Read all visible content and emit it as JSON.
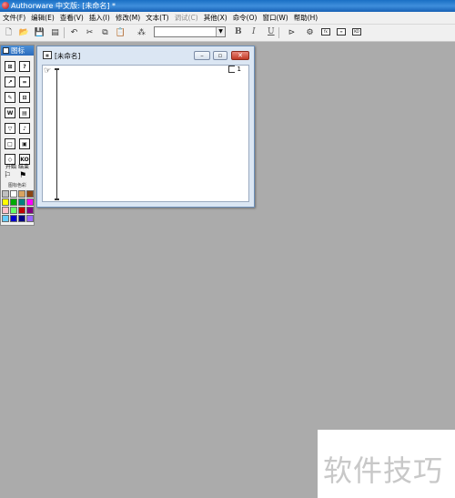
{
  "window": {
    "title": "Authorware 中文版: [未命名] *"
  },
  "menu": [
    {
      "label": "文件(F)",
      "disabled": false
    },
    {
      "label": "编辑(E)",
      "disabled": false
    },
    {
      "label": "查看(V)",
      "disabled": false
    },
    {
      "label": "插入(I)",
      "disabled": false
    },
    {
      "label": "修改(M)",
      "disabled": false
    },
    {
      "label": "文本(T)",
      "disabled": false
    },
    {
      "label": "调试(C)",
      "disabled": true
    },
    {
      "label": "其他(X)",
      "disabled": false
    },
    {
      "label": "命令(O)",
      "disabled": false
    },
    {
      "label": "窗口(W)",
      "disabled": false
    },
    {
      "label": "帮助(H)",
      "disabled": false
    }
  ],
  "toolbar": {
    "style_value": "",
    "bold_label": "B",
    "italic_label": "I",
    "underline_label": "U",
    "icons": [
      "new-file-icon",
      "open-file-icon",
      "save-all-icon",
      "import-icon",
      "undo-icon",
      "cut-icon",
      "copy-icon",
      "paste-icon",
      "find-icon"
    ],
    "right_icons": [
      "run-icon",
      "control-panel-icon",
      "functions-icon",
      "variables-icon",
      "knowledge-objects-icon"
    ]
  },
  "palette": {
    "title": "图标",
    "icons": [
      {
        "name": "display-icon",
        "glyph": "⊞"
      },
      {
        "name": "interaction-icon",
        "glyph": "?"
      },
      {
        "name": "motion-icon",
        "glyph": "↗"
      },
      {
        "name": "calculation-icon",
        "glyph": "="
      },
      {
        "name": "erase-icon",
        "glyph": "✎"
      },
      {
        "name": "map-icon",
        "glyph": "⊟"
      },
      {
        "name": "wait-icon",
        "glyph": "W"
      },
      {
        "name": "digital-movie-icon",
        "glyph": "▤"
      },
      {
        "name": "navigate-icon",
        "glyph": "▽"
      },
      {
        "name": "sound-icon",
        "glyph": "♪"
      },
      {
        "name": "framework-icon",
        "glyph": "□"
      },
      {
        "name": "video-icon",
        "glyph": "▣"
      },
      {
        "name": "decision-icon",
        "glyph": "◇"
      },
      {
        "name": "knowledge-object-icon",
        "glyph": "KO"
      }
    ],
    "flags_label": "开始  结束",
    "color_label": "图标色彩",
    "colors": [
      "#c0c0c0",
      "#ffffff",
      "#d9a35f",
      "#8b4513",
      "#ffff00",
      "#00aa00",
      "#008080",
      "#ff00ff",
      "#ffc0cb",
      "#66ff66",
      "#c00000",
      "#800080",
      "#66ccff",
      "#0000cc",
      "#000080",
      "#9966ff"
    ]
  },
  "child_window": {
    "title": "[未命名]",
    "level_label": "1"
  },
  "watermark": {
    "text": "软件技巧"
  }
}
